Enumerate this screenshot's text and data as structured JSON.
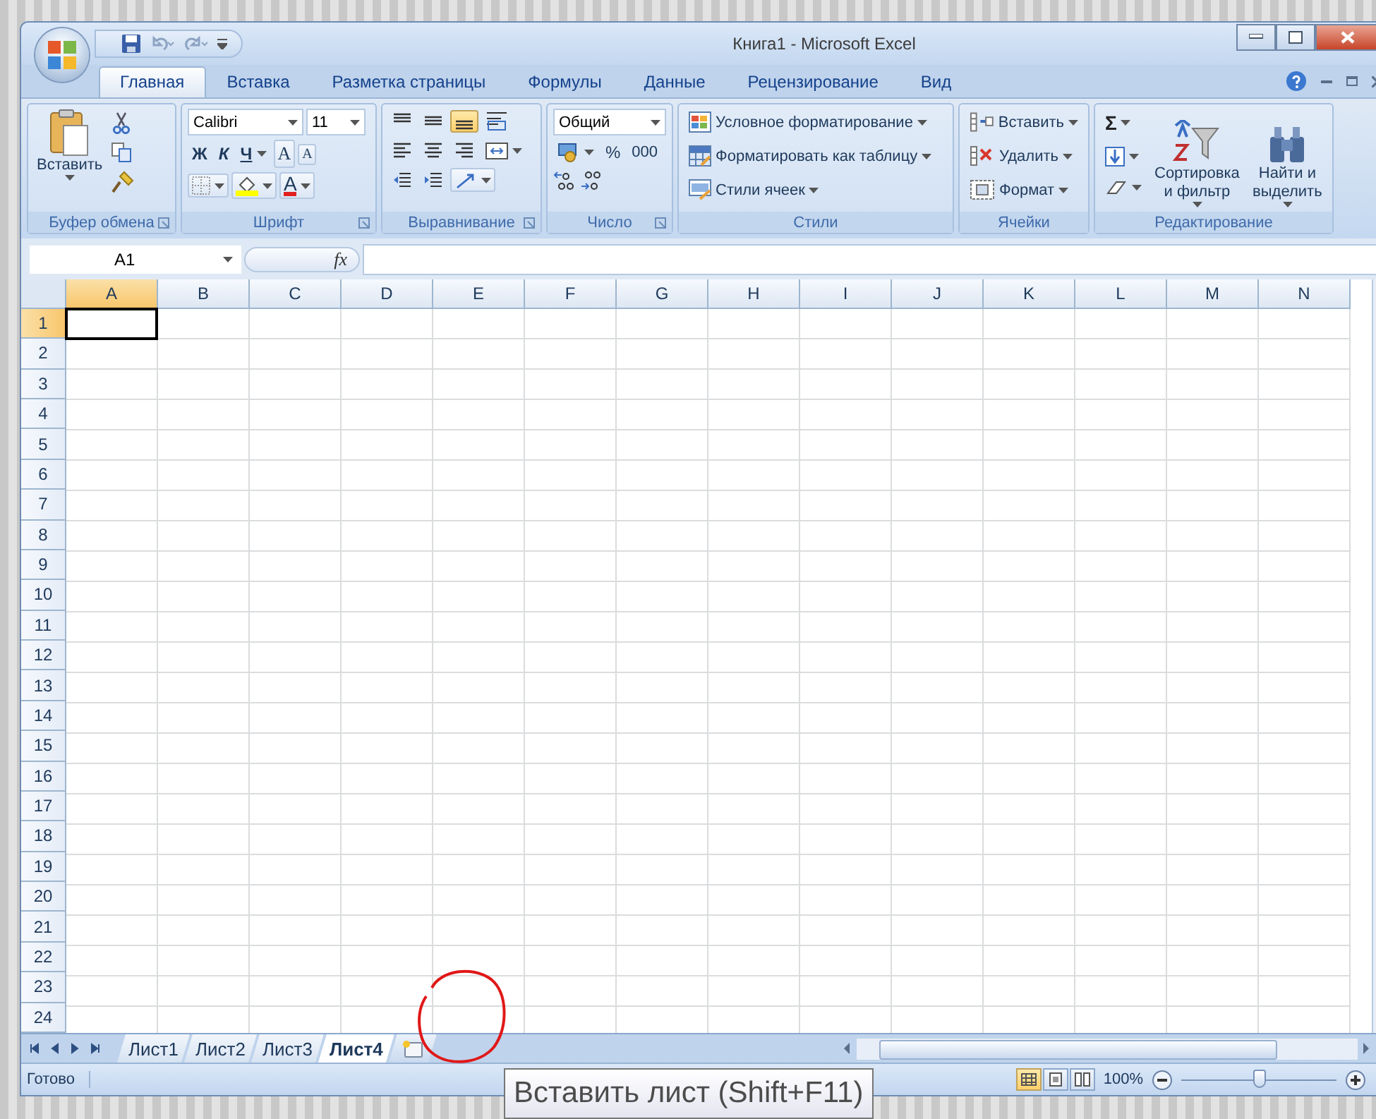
{
  "window": {
    "title": "Книга1 - Microsoft Excel"
  },
  "ribbon_tabs": [
    {
      "label": "Главная",
      "selected": true
    },
    {
      "label": "Вставка",
      "selected": false
    },
    {
      "label": "Разметка страницы",
      "selected": false
    },
    {
      "label": "Формулы",
      "selected": false
    },
    {
      "label": "Данные",
      "selected": false
    },
    {
      "label": "Рецензирование",
      "selected": false
    },
    {
      "label": "Вид",
      "selected": false
    }
  ],
  "clipboard": {
    "title": "Буфер обмена",
    "paste": "Вставить"
  },
  "font": {
    "title": "Шрифт",
    "name": "Calibri",
    "size": "11",
    "bold": "Ж",
    "italic": "К",
    "underline": "Ч",
    "grow": "A",
    "shrink": "A",
    "color_button": "A"
  },
  "alignment": {
    "title": "Выравнивание"
  },
  "number": {
    "title": "Число",
    "format": "Общий",
    "percent": "%",
    "thousands": "000"
  },
  "styles": {
    "title": "Стили",
    "commands": [
      {
        "label": "Условное форматирование",
        "kind": "conditional"
      },
      {
        "label": "Форматировать как таблицу",
        "kind": "table"
      },
      {
        "label": "Стили ячеек",
        "kind": "cell_styles"
      }
    ]
  },
  "cells": {
    "title": "Ячейки",
    "commands": [
      {
        "label": "Вставить",
        "kind": "insert"
      },
      {
        "label": "Удалить",
        "kind": "delete"
      },
      {
        "label": "Формат",
        "kind": "format"
      }
    ]
  },
  "editing": {
    "title": "Редактирование",
    "sum": "Σ",
    "sort": "Сортировка и фильтр",
    "find": "Найти и выделить"
  },
  "formula_bar": {
    "name_box": "A1",
    "fx": "fx"
  },
  "columns": [
    {
      "label": "A",
      "selected": true
    },
    {
      "label": "B",
      "selected": false
    },
    {
      "label": "C",
      "selected": false
    },
    {
      "label": "D",
      "selected": false
    },
    {
      "label": "E",
      "selected": false
    },
    {
      "label": "F",
      "selected": false
    },
    {
      "label": "G",
      "selected": false
    },
    {
      "label": "H",
      "selected": false
    },
    {
      "label": "I",
      "selected": false
    },
    {
      "label": "J",
      "selected": false
    },
    {
      "label": "K",
      "selected": false
    },
    {
      "label": "L",
      "selected": false
    },
    {
      "label": "M",
      "selected": false
    },
    {
      "label": "N",
      "selected": false
    }
  ],
  "rows": [
    {
      "label": "1",
      "selected": true
    },
    {
      "label": "2",
      "selected": false
    },
    {
      "label": "3",
      "selected": false
    },
    {
      "label": "4",
      "selected": false
    },
    {
      "label": "5",
      "selected": false
    },
    {
      "label": "6",
      "selected": false
    },
    {
      "label": "7",
      "selected": false
    },
    {
      "label": "8",
      "selected": false
    },
    {
      "label": "9",
      "selected": false
    },
    {
      "label": "10",
      "selected": false
    },
    {
      "label": "11",
      "selected": false
    },
    {
      "label": "12",
      "selected": false
    },
    {
      "label": "13",
      "selected": false
    },
    {
      "label": "14",
      "selected": false
    },
    {
      "label": "15",
      "selected": false
    },
    {
      "label": "16",
      "selected": false
    },
    {
      "label": "17",
      "selected": false
    },
    {
      "label": "18",
      "selected": false
    },
    {
      "label": "19",
      "selected": false
    },
    {
      "label": "20",
      "selected": false
    },
    {
      "label": "21",
      "selected": false
    },
    {
      "label": "22",
      "selected": false
    },
    {
      "label": "23",
      "selected": false
    },
    {
      "label": "24",
      "selected": false
    }
  ],
  "sheets": [
    {
      "label": "Лист1",
      "selected": false
    },
    {
      "label": "Лист2",
      "selected": false
    },
    {
      "label": "Лист3",
      "selected": false
    },
    {
      "label": "Лист4",
      "selected": true
    }
  ],
  "status_bar": {
    "text": "Готово",
    "views": [
      {
        "kind": "normal",
        "selected": true
      },
      {
        "kind": "page_layout",
        "selected": false
      },
      {
        "kind": "page_break",
        "selected": false
      }
    ],
    "zoom": {
      "text": "100%",
      "level": 0.5
    }
  },
  "tooltip": {
    "text": "Вставить лист (Shift+F11)"
  }
}
